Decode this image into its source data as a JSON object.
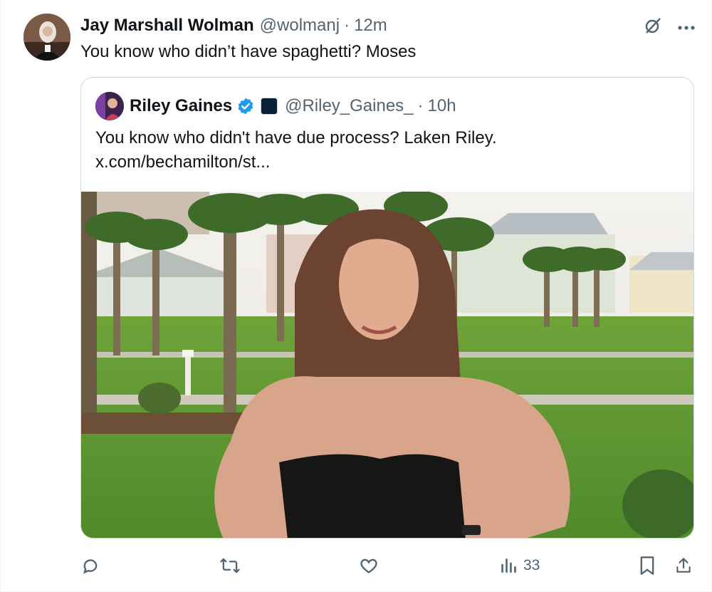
{
  "tweet": {
    "author_name": "Jay Marshall Wolman",
    "handle": "@wolmanj",
    "separator": "·",
    "time": "12m",
    "text": "You know who didn’t have spaghetti? Moses"
  },
  "quote": {
    "author_name": "Riley Gaines",
    "handle": "@Riley_Gaines_",
    "separator": "·",
    "time": "10h",
    "text_line1": "You know who didn't have due process? Laken Riley.",
    "text_line2": "x.com/bechamilton/st..."
  },
  "actions": {
    "reply_icon": "reply-icon",
    "retweet_icon": "retweet-icon",
    "like_icon": "like-icon",
    "views_icon": "views-icon",
    "views_count": "33",
    "bookmark_icon": "bookmark-icon",
    "share_icon": "share-icon"
  },
  "colors": {
    "verified": "#1d9bf0",
    "muted": "#536471",
    "border": "#cfd9de"
  }
}
